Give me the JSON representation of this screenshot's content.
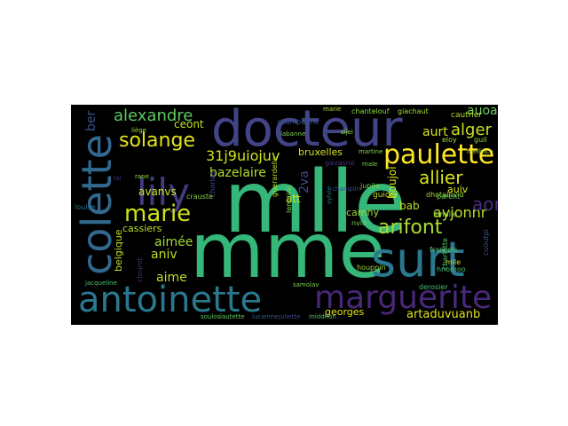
{
  "words": [
    {
      "text": "mlle",
      "color": "#35b779"
    },
    {
      "text": "mme",
      "color": "#35b779"
    },
    {
      "text": "docteur",
      "color": "#414487"
    },
    {
      "text": "surt",
      "color": "#2a788e"
    },
    {
      "text": "antoinette",
      "color": "#2a788e"
    },
    {
      "text": "marguerite",
      "color": "#482878"
    },
    {
      "text": "colette",
      "color": "#31688e"
    },
    {
      "text": "lily",
      "color": "#443983"
    },
    {
      "text": "paulette",
      "color": "#fde725"
    },
    {
      "text": "marie",
      "color": "#cde11d"
    },
    {
      "text": "solange",
      "color": "#e5e419"
    },
    {
      "text": "alexandre",
      "color": "#5ec962"
    },
    {
      "text": "31j9uiojuv",
      "color": "#d0e11c"
    },
    {
      "text": "bazelaire",
      "color": "#b5de2b"
    },
    {
      "text": "allier",
      "color": "#d8e219"
    },
    {
      "text": "arifont",
      "color": "#aadc32"
    },
    {
      "text": "ayjonnr",
      "color": "#c2df23"
    },
    {
      "text": "artaduvuanb",
      "color": "#dde318"
    },
    {
      "text": "alger",
      "color": "#c8e020"
    },
    {
      "text": "aurt",
      "color": "#d2e21b"
    },
    {
      "text": "auoa",
      "color": "#6ccd5a"
    },
    {
      "text": "aord",
      "color": "#472d7b"
    },
    {
      "text": "ber",
      "color": "#3b528b"
    },
    {
      "text": "aime",
      "color": "#b8de29"
    },
    {
      "text": "aniv",
      "color": "#c0df25"
    },
    {
      "text": "aimée",
      "color": "#a2da37"
    },
    {
      "text": "avanvs",
      "color": "#cae11f"
    },
    {
      "text": "georges",
      "color": "#e7e419"
    },
    {
      "text": "ceont",
      "color": "#c2df23"
    },
    {
      "text": "att",
      "color": "#dde318"
    },
    {
      "text": "bab",
      "color": "#b5de2b"
    },
    {
      "text": "boujol",
      "color": "#d5e21a"
    },
    {
      "text": "bruxelles",
      "color": "#d2e21b"
    },
    {
      "text": "camhy",
      "color": "#9bd93c"
    },
    {
      "text": "cassiers",
      "color": "#b8de29"
    },
    {
      "text": "belgique",
      "color": "#bade28"
    },
    {
      "text": "auiv",
      "color": "#d5e21a"
    },
    {
      "text": "2va",
      "color": "#3e4989"
    },
    {
      "text": "cautrier",
      "color": "#b5de2b"
    },
    {
      "text": "chantelouf",
      "color": "#8fd744"
    },
    {
      "text": "giachaut",
      "color": "#a8db34"
    },
    {
      "text": "guidel",
      "color": "#c0df25"
    },
    {
      "text": "dhotalnvid",
      "color": "#a2da37"
    },
    {
      "text": "houppin",
      "color": "#95d840"
    },
    {
      "text": "françois",
      "color": "#5ec962"
    },
    {
      "text": "derosier",
      "color": "#4ac16d"
    },
    {
      "text": "charlotte",
      "color": "#52c569"
    },
    {
      "text": "gavasno",
      "color": "#46327e"
    },
    {
      "text": "champagne",
      "color": "#3b528b"
    },
    {
      "text": "jupile",
      "color": "#7ad151"
    },
    {
      "text": "famille",
      "color": "#8fd744"
    },
    {
      "text": "parent",
      "color": "#6ccd5a"
    },
    {
      "text": "eloy",
      "color": "#a5db36"
    },
    {
      "text": "guil",
      "color": "#9bd93c"
    },
    {
      "text": "mellince",
      "color": "#b0dd2f"
    },
    {
      "text": "louise",
      "color": "#2c718e"
    },
    {
      "text": "charles",
      "color": "#3e4989"
    },
    {
      "text": "crauste",
      "color": "#86d549"
    },
    {
      "text": "clourot",
      "color": "#46327e"
    },
    {
      "text": "jacqueline",
      "color": "#52c569"
    },
    {
      "text": "samolav",
      "color": "#7ad151"
    },
    {
      "text": "middhoh",
      "color": "#4ac16d"
    },
    {
      "text": "lautette",
      "color": "#63cb5f"
    },
    {
      "text": "soulos",
      "color": "#5ec962"
    },
    {
      "text": "lucienne",
      "color": "#38588c"
    },
    {
      "text": "juliette",
      "color": "#404688"
    },
    {
      "text": "guerardelle",
      "color": "#b5de2b"
    },
    {
      "text": "lemaire",
      "color": "#7ad151"
    },
    {
      "text": "hnomoo",
      "color": "#4ac16d"
    },
    {
      "text": "mile",
      "color": "#c2df23"
    },
    {
      "text": "cuoutpi",
      "color": "#3b528b"
    },
    {
      "text": "champlin",
      "color": "#3e4989"
    },
    {
      "text": "nvid",
      "color": "#6ccd5a"
    },
    {
      "text": "sijei",
      "color": "#8fd744"
    },
    {
      "text": "labanne",
      "color": "#7ad151"
    },
    {
      "text": "marie",
      "color": "#b0dd2f"
    },
    {
      "text": "sylvie",
      "color": "#2a788e"
    },
    {
      "text": "rane",
      "color": "#95d840"
    },
    {
      "text": "lai",
      "color": "#46327e"
    },
    {
      "text": "liège",
      "color": "#a2da37"
    },
    {
      "text": "martine",
      "color": "#86d549"
    },
    {
      "text": "male",
      "color": "#7ad151"
    }
  ]
}
